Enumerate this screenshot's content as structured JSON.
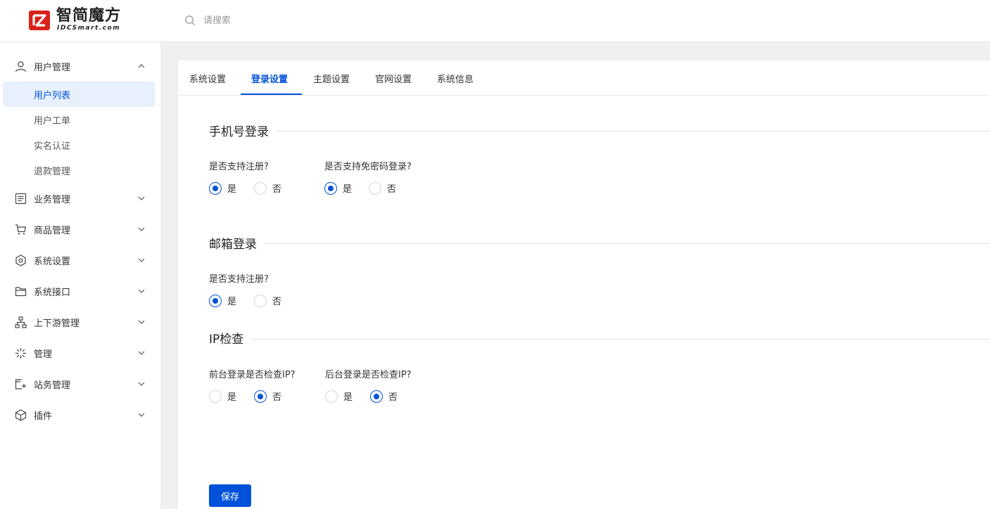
{
  "brand": {
    "name": "智简魔方",
    "sub": "IDCSmart.com",
    "red": "#d9221a"
  },
  "search": {
    "placeholder": "请搜索"
  },
  "colors": {
    "accent": "#0052d9",
    "active_bg": "#e8f0fe"
  },
  "sidebar": {
    "groups": [
      {
        "label": "用户管理",
        "icon": "user-icon",
        "expanded": true,
        "items": [
          {
            "label": "用户列表",
            "active": true
          },
          {
            "label": "用户工单"
          },
          {
            "label": "实名认证"
          },
          {
            "label": "退款管理"
          }
        ]
      },
      {
        "label": "业务管理",
        "icon": "list-icon"
      },
      {
        "label": "商品管理",
        "icon": "cart-icon"
      },
      {
        "label": "系统设置",
        "icon": "hexagon-settings-icon"
      },
      {
        "label": "系统接口",
        "icon": "folder-icon"
      },
      {
        "label": "上下游管理",
        "icon": "hierarchy-icon"
      },
      {
        "label": "管理",
        "icon": "sparkle-icon"
      },
      {
        "label": "站务管理",
        "icon": "window-add-icon"
      },
      {
        "label": "插件",
        "icon": "cube-icon"
      }
    ]
  },
  "tabs": [
    {
      "label": "系统设置"
    },
    {
      "label": "登录设置",
      "active": true
    },
    {
      "label": "主题设置"
    },
    {
      "label": "官网设置"
    },
    {
      "label": "系统信息"
    }
  ],
  "sections": {
    "phone": {
      "title": "手机号登录",
      "q1": {
        "label": "是否支持注册?",
        "yes": "是",
        "no": "否",
        "selected": "yes"
      },
      "q2": {
        "label": "是否支持免密码登录?",
        "yes": "是",
        "no": "否",
        "selected": "yes"
      }
    },
    "email": {
      "title": "邮箱登录",
      "q1": {
        "label": "是否支持注册?",
        "yes": "是",
        "no": "否",
        "selected": "yes"
      }
    },
    "ip": {
      "title": "IP检查",
      "q1": {
        "label": "前台登录是否检查IP?",
        "yes": "是",
        "no": "否",
        "selected": "no"
      },
      "q2": {
        "label": "后台登录是否检查IP?",
        "yes": "是",
        "no": "否",
        "selected": "no"
      }
    }
  },
  "save_label": "保存"
}
